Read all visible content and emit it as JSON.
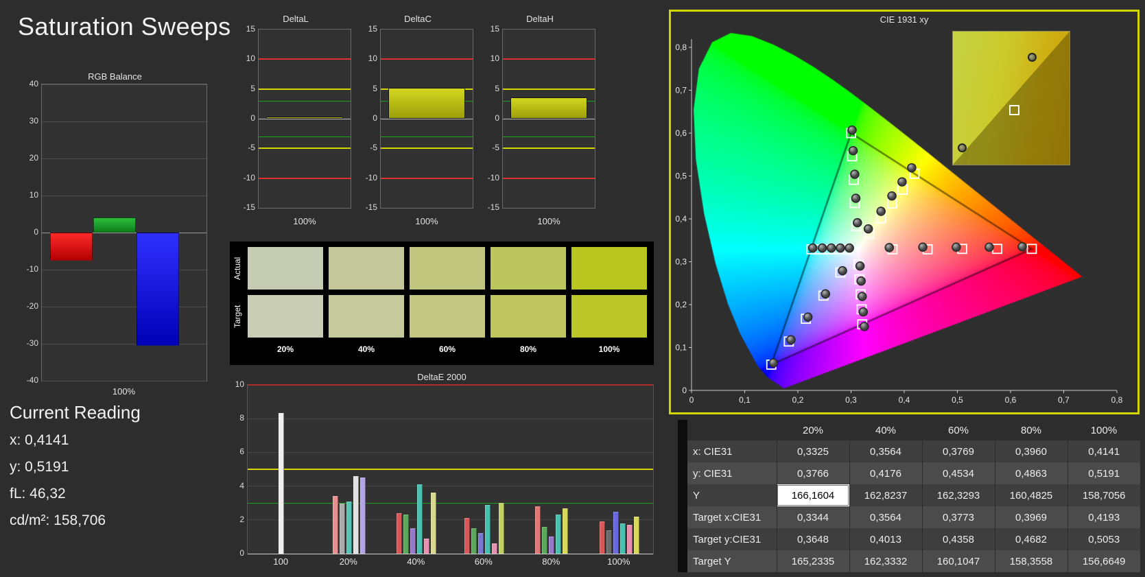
{
  "page": {
    "title": "Saturation Sweeps",
    "bg": "#2d2d2d",
    "accent_border": "#d4d600"
  },
  "reading": {
    "heading": "Current Reading",
    "lines": [
      "x: 0,4141",
      "y: 0,5191",
      "fL: 46,32",
      "cd/m²: 158,706"
    ]
  },
  "chart_data": [
    {
      "type": "bar",
      "title": "RGB Balance",
      "xlabel": "100%",
      "ylim": [
        -40,
        40
      ],
      "yticks": [
        40,
        30,
        20,
        10,
        0,
        -10,
        -20,
        -30,
        -40
      ],
      "categories": [
        "Red",
        "Green",
        "Blue"
      ],
      "values": [
        -7.5,
        4,
        -30.5
      ],
      "colors": [
        "#e01010",
        "#18a028",
        "#1818e8"
      ]
    },
    {
      "type": "bar",
      "title": "DeltaL",
      "xlabel": "100%",
      "ylim": [
        -15,
        15
      ],
      "yticks": [
        15,
        10,
        5,
        0,
        -5,
        -10,
        -15
      ],
      "limit_lines": {
        "red": 10,
        "yellow": 5,
        "green": 3
      },
      "values": [
        0.3
      ],
      "bar_color": "#b8bc12"
    },
    {
      "type": "bar",
      "title": "DeltaC",
      "xlabel": "100%",
      "ylim": [
        -15,
        15
      ],
      "yticks": [
        15,
        10,
        5,
        0,
        -5,
        -10,
        -15
      ],
      "limit_lines": {
        "red": 10,
        "yellow": 5,
        "green": 3
      },
      "values": [
        5.2
      ],
      "bar_color": "#b8bc12"
    },
    {
      "type": "bar",
      "title": "DeltaH",
      "xlabel": "100%",
      "ylim": [
        -15,
        15
      ],
      "yticks": [
        15,
        10,
        5,
        0,
        -5,
        -10,
        -15
      ],
      "limit_lines": {
        "red": 10,
        "yellow": 5,
        "green": 3
      },
      "values": [
        3.6
      ],
      "bar_color": "#b8bc12"
    },
    {
      "type": "bar",
      "title": "DeltaE 2000",
      "ylim": [
        0,
        10
      ],
      "yticks": [
        0,
        2,
        4,
        6,
        8,
        10
      ],
      "limit_lines": {
        "red": 10,
        "yellow": 5,
        "green": 3
      },
      "groups": [
        {
          "label": "100",
          "bars": [
            {
              "color": "#efefef",
              "value": 8.35
            }
          ]
        },
        {
          "label": "20%",
          "bars": [
            {
              "color": "#e89090",
              "value": 3.4
            },
            {
              "color": "#ababab",
              "value": 2.95
            },
            {
              "color": "#55c6b5",
              "value": 3.1
            },
            {
              "color": "#e2e2e2",
              "value": 4.6
            },
            {
              "color": "#b4a4e6",
              "value": 4.5
            }
          ]
        },
        {
          "label": "40%",
          "bars": [
            {
              "color": "#d85858",
              "value": 2.4
            },
            {
              "color": "#5aa85a",
              "value": 2.3
            },
            {
              "color": "#9878c8",
              "value": 1.5
            },
            {
              "color": "#48c0b0",
              "value": 4.1
            },
            {
              "color": "#e890b0",
              "value": 0.9
            },
            {
              "color": "#d8d890",
              "value": 3.6
            }
          ]
        },
        {
          "label": "60%",
          "bars": [
            {
              "color": "#d85858",
              "value": 2.1
            },
            {
              "color": "#5aa85a",
              "value": 1.5
            },
            {
              "color": "#7878d0",
              "value": 1.2
            },
            {
              "color": "#48c0b0",
              "value": 2.9
            },
            {
              "color": "#e890b0",
              "value": 0.6
            },
            {
              "color": "#c0d060",
              "value": 3.0
            }
          ]
        },
        {
          "label": "80%",
          "bars": [
            {
              "color": "#e07878",
              "value": 2.8
            },
            {
              "color": "#5aa85a",
              "value": 1.6
            },
            {
              "color": "#9878c8",
              "value": 1.0
            },
            {
              "color": "#48c0b0",
              "value": 2.3
            },
            {
              "color": "#d8d858",
              "value": 2.7
            }
          ]
        },
        {
          "label": "100%",
          "bars": [
            {
              "color": "#d85858",
              "value": 1.9
            },
            {
              "color": "#6a6a6a",
              "value": 1.4
            },
            {
              "color": "#6868e0",
              "value": 2.5
            },
            {
              "color": "#48c0b0",
              "value": 1.8
            },
            {
              "color": "#e890b0",
              "value": 1.7
            },
            {
              "color": "#d8d858",
              "value": 2.2
            }
          ]
        }
      ]
    },
    {
      "type": "scatter",
      "title": "CIE 1931 xy",
      "xlim": [
        0,
        0.8
      ],
      "ylim": [
        0,
        0.8
      ],
      "xticks": [
        "0",
        "0,1",
        "0,2",
        "0,3",
        "0,4",
        "0,5",
        "0,6",
        "0,7",
        "0,8"
      ],
      "yticks": [
        "0",
        "0,1",
        "0,2",
        "0,3",
        "0,4",
        "0,5",
        "0,6",
        "0,7",
        "0,8"
      ],
      "targets": [
        [
          0.31,
          0.383
        ],
        [
          0.307,
          0.437
        ],
        [
          0.305,
          0.491
        ],
        [
          0.302,
          0.546
        ],
        [
          0.3,
          0.6
        ],
        [
          0.3344,
          0.3648
        ],
        [
          0.3564,
          0.4013
        ],
        [
          0.3773,
          0.4358
        ],
        [
          0.3969,
          0.4682
        ],
        [
          0.4193,
          0.5053
        ],
        [
          0.378,
          0.329
        ],
        [
          0.444,
          0.329
        ],
        [
          0.509,
          0.33
        ],
        [
          0.575,
          0.33
        ],
        [
          0.64,
          0.33
        ],
        [
          0.314,
          0.294
        ],
        [
          0.316,
          0.259
        ],
        [
          0.318,
          0.224
        ],
        [
          0.32,
          0.189
        ],
        [
          0.321,
          0.154
        ],
        [
          0.28,
          0.275
        ],
        [
          0.248,
          0.221
        ],
        [
          0.215,
          0.167
        ],
        [
          0.183,
          0.114
        ],
        [
          0.15,
          0.06
        ],
        [
          0.295,
          0.329
        ],
        [
          0.277,
          0.329
        ],
        [
          0.26,
          0.329
        ],
        [
          0.242,
          0.329
        ],
        [
          0.225,
          0.329
        ]
      ],
      "measured": [
        [
          0.312,
          0.391
        ],
        [
          0.309,
          0.448
        ],
        [
          0.307,
          0.504
        ],
        [
          0.304,
          0.559
        ],
        [
          0.302,
          0.607
        ],
        [
          0.3325,
          0.3766
        ],
        [
          0.3564,
          0.4176
        ],
        [
          0.3769,
          0.4534
        ],
        [
          0.396,
          0.4863
        ],
        [
          0.4141,
          0.5191
        ],
        [
          0.372,
          0.333
        ],
        [
          0.435,
          0.334
        ],
        [
          0.498,
          0.334
        ],
        [
          0.56,
          0.334
        ],
        [
          0.622,
          0.335
        ],
        [
          0.317,
          0.29
        ],
        [
          0.319,
          0.255
        ],
        [
          0.321,
          0.219
        ],
        [
          0.323,
          0.183
        ],
        [
          0.325,
          0.149
        ],
        [
          0.284,
          0.279
        ],
        [
          0.252,
          0.225
        ],
        [
          0.219,
          0.171
        ],
        [
          0.187,
          0.118
        ],
        [
          0.154,
          0.064
        ],
        [
          0.297,
          0.332
        ],
        [
          0.28,
          0.332
        ],
        [
          0.263,
          0.332
        ],
        [
          0.246,
          0.332
        ],
        [
          0.228,
          0.332
        ]
      ],
      "inset": {
        "markers": [
          {
            "type": "circle",
            "x": 0.64,
            "y": 0.16
          },
          {
            "type": "square",
            "x": 0.48,
            "y": 0.55
          },
          {
            "type": "circle",
            "x": 0.04,
            "y": 0.84
          }
        ]
      }
    }
  ],
  "swatches": {
    "row_labels": [
      "Actual",
      "Target"
    ],
    "col_labels": [
      "20%",
      "40%",
      "60%",
      "80%",
      "100%"
    ],
    "actual": [
      "#c6cbb4",
      "#c4c79a",
      "#c1c57e",
      "#bdc55e",
      "#b9c61f"
    ],
    "target": [
      "#c9cdb6",
      "#c6c99c",
      "#c3c680",
      "#bfc65f",
      "#bbc728"
    ]
  },
  "table": {
    "columns": [
      "20%",
      "40%",
      "60%",
      "80%",
      "100%"
    ],
    "rows": [
      {
        "label": "x: CIE31",
        "values": [
          "0,3325",
          "0,3564",
          "0,3769",
          "0,3960",
          "0,4141"
        ]
      },
      {
        "label": "y: CIE31",
        "values": [
          "0,3766",
          "0,4176",
          "0,4534",
          "0,4863",
          "0,5191"
        ]
      },
      {
        "label": "Y",
        "values": [
          "166,1604",
          "162,8237",
          "162,3293",
          "160,4825",
          "158,7056"
        ]
      },
      {
        "label": "Target x:CIE31",
        "values": [
          "0,3344",
          "0,3564",
          "0,3773",
          "0,3969",
          "0,4193"
        ]
      },
      {
        "label": "Target y:CIE31",
        "values": [
          "0,3648",
          "0,4013",
          "0,4358",
          "0,4682",
          "0,5053"
        ]
      },
      {
        "label": "Target Y",
        "values": [
          "165,2335",
          "162,3332",
          "160,1047",
          "158,3558",
          "156,6649"
        ]
      }
    ],
    "highlight": {
      "row": 2,
      "col": 0
    }
  }
}
